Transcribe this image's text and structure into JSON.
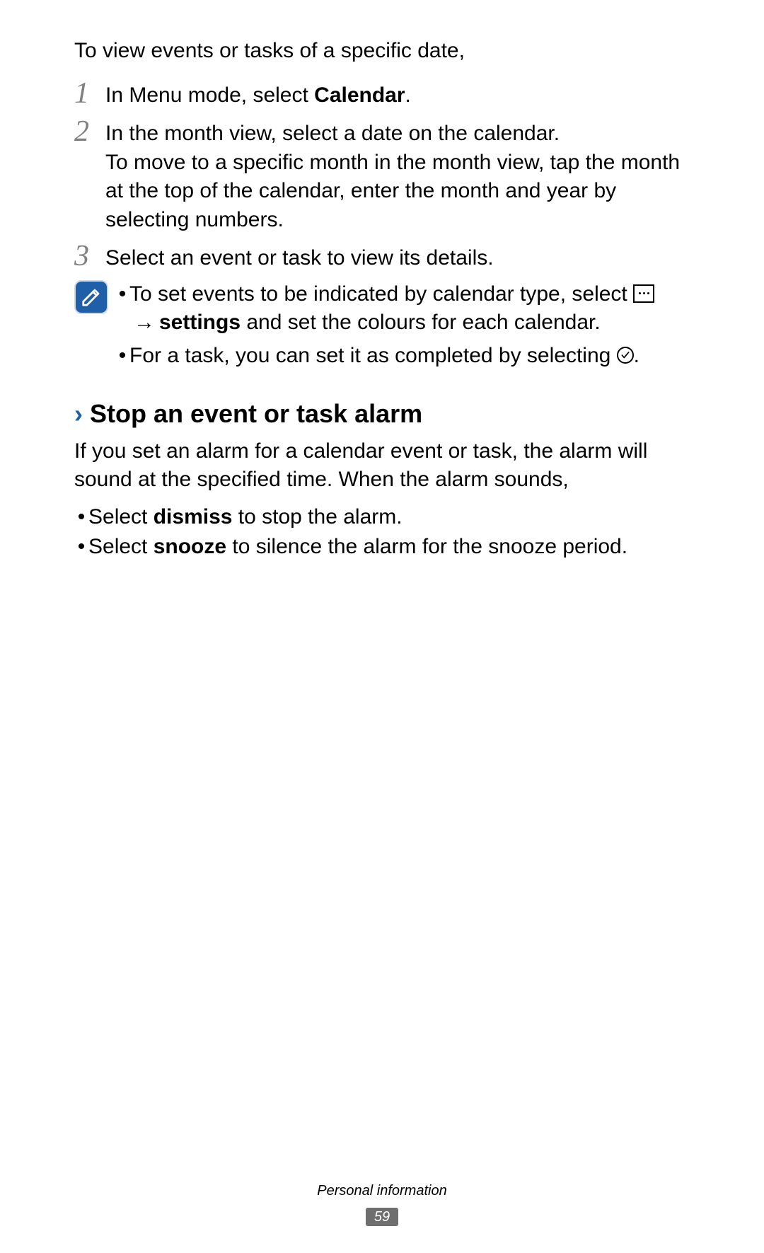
{
  "intro": "To view events or tasks of a specific date,",
  "steps": [
    {
      "num": "1",
      "pre": "In Menu mode, select ",
      "bold": "Calendar",
      "post": "."
    },
    {
      "num": "2",
      "line1": "In the month view, select a date on the calendar.",
      "line2": "To move to a specific month in the month view, tap the month at the top of the calendar, enter the month and year by selecting numbers."
    },
    {
      "num": "3",
      "line1": "Select an event or task to view its details."
    }
  ],
  "note": {
    "item1_pre": "To set events to be indicated by calendar type, select ",
    "item1_bold": "settings",
    "item1_post": " and set the colours for each calendar.",
    "item2_pre": "For a task, you can set it as completed by selecting ",
    "item2_post": "."
  },
  "section": {
    "heading": "Stop an event or task alarm",
    "intro": "If you set an alarm for a calendar event or task, the alarm will sound at the specified time. When the alarm sounds,",
    "bullets": [
      {
        "pre": "Select ",
        "bold": "dismiss",
        "post": " to stop the alarm."
      },
      {
        "pre": "Select ",
        "bold": "snooze",
        "post": " to silence the alarm for the snooze period."
      }
    ]
  },
  "footer": {
    "section": "Personal information",
    "page": "59"
  },
  "icons": {
    "note": "note-icon",
    "more": "more-menu-icon",
    "arrow": "→",
    "check": "check-circle-icon",
    "chevron": "›"
  }
}
